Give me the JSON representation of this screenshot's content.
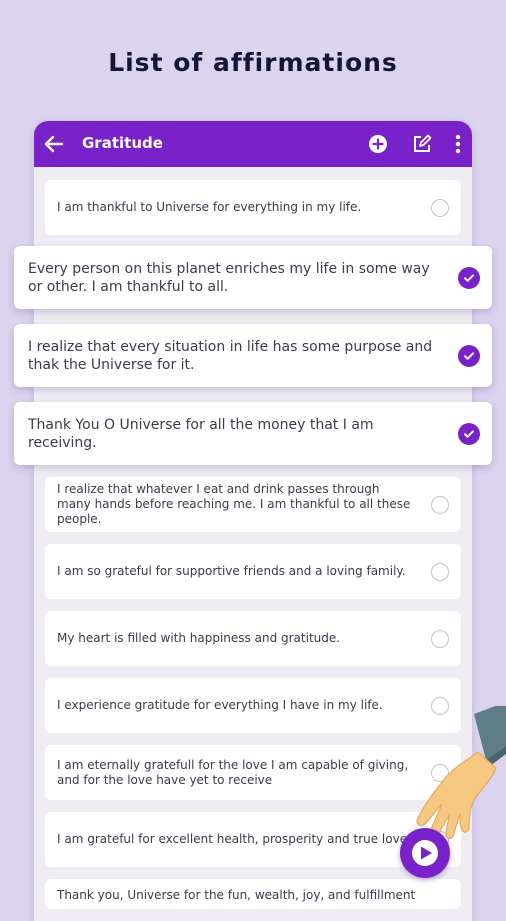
{
  "headline": "List of affirmations",
  "app_bar": {
    "title": "Gratitude",
    "back_icon": "arrow-left-icon",
    "add_icon": "plus-circle-icon",
    "edit_icon": "edit-icon",
    "more_icon": "more-vertical-icon"
  },
  "affirmations": [
    {
      "text": "I am thankful to Universe for everything in my life.",
      "checked": false
    },
    {
      "text": "Every person on this planet enriches my life in some way or other. I am thankful to all.",
      "checked": true
    },
    {
      "text": "I realize that every situation in life has some purpose and thak the Universe for it.",
      "checked": true
    },
    {
      "text": "Thank You O Universe for all the money that I am receiving.",
      "checked": true
    },
    {
      "text": "I realize that whatever I eat and drink passes through many hands before reaching me. I am thankful to all these people.",
      "checked": false
    },
    {
      "text": "I am so grateful for supportive friends and a loving family.",
      "checked": false
    },
    {
      "text": "My heart is filled with happiness and gratitude.",
      "checked": false
    },
    {
      "text": "I experience gratitude for everything I have in my life.",
      "checked": false
    },
    {
      "text": "I am eternally gratefull for the love I am capable of giving, and for the love have yet to receive",
      "checked": false
    },
    {
      "text": "I am grateful for excellent health, prosperity and true love.",
      "checked": false
    },
    {
      "text": "Thank you, Universe for the fun, wealth, joy, and fulfillment",
      "checked": false
    }
  ],
  "colors": {
    "accent": "#7a22c9",
    "background": "#dcd3ef"
  },
  "fab_icon": "play-icon"
}
